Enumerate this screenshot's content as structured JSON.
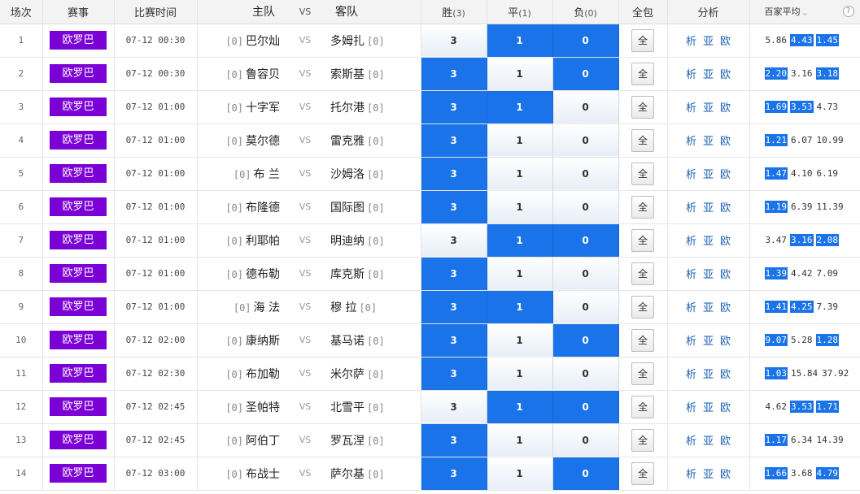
{
  "header": {
    "idx": "场次",
    "league": "赛事",
    "time": "比赛时间",
    "home": "主队",
    "vs": "VS",
    "away": "客队",
    "win": "胜",
    "win_sub": "(3)",
    "draw": "平",
    "draw_sub": "(1)",
    "loss": "负",
    "loss_sub": "(0)",
    "all": "全包",
    "analysis": "分析",
    "avg": "百家平均",
    "chevron_icon": "chevron-down-icon",
    "help_icon": "help-icon",
    "help": "?"
  },
  "labels": {
    "vs": "VS",
    "all": "全",
    "ana": [
      "析",
      "亚",
      "欧"
    ]
  },
  "colors": {
    "league_badge": "#7b00d6",
    "selected_cell": "#1a73e8",
    "link": "#1a5fb4"
  },
  "rows": [
    {
      "idx": "1",
      "league": "欧罗巴",
      "time": "07-12 00:30",
      "home_hc": "[0]",
      "home": "巴尔灿",
      "away": "多姆扎",
      "away_hc": "[0]",
      "picks": [
        false,
        true,
        true
      ],
      "odds": [
        {
          "v": "5.86",
          "hi": false
        },
        {
          "v": "4.43",
          "hi": true
        },
        {
          "v": "1.45",
          "hi": true
        }
      ]
    },
    {
      "idx": "2",
      "league": "欧罗巴",
      "time": "07-12 00:30",
      "home_hc": "[0]",
      "home": "鲁容贝",
      "away": "索斯基",
      "away_hc": "[0]",
      "picks": [
        true,
        false,
        true
      ],
      "odds": [
        {
          "v": "2.20",
          "hi": true
        },
        {
          "v": "3.16",
          "hi": false
        },
        {
          "v": "3.18",
          "hi": true
        }
      ]
    },
    {
      "idx": "3",
      "league": "欧罗巴",
      "time": "07-12 01:00",
      "home_hc": "[0]",
      "home": "十字军",
      "away": "托尔港",
      "away_hc": "[0]",
      "picks": [
        true,
        true,
        false
      ],
      "odds": [
        {
          "v": "1.69",
          "hi": true
        },
        {
          "v": "3.53",
          "hi": true
        },
        {
          "v": "4.73",
          "hi": false
        }
      ]
    },
    {
      "idx": "4",
      "league": "欧罗巴",
      "time": "07-12 01:00",
      "home_hc": "[0]",
      "home": "莫尔德",
      "away": "雷克雅",
      "away_hc": "[0]",
      "picks": [
        true,
        false,
        false
      ],
      "odds": [
        {
          "v": "1.21",
          "hi": true
        },
        {
          "v": "6.07",
          "hi": false
        },
        {
          "v": "10.99",
          "hi": false
        }
      ]
    },
    {
      "idx": "5",
      "league": "欧罗巴",
      "time": "07-12 01:00",
      "home_hc": "[0]",
      "home": "布 兰",
      "away": "沙姆洛",
      "away_hc": "[0]",
      "picks": [
        true,
        false,
        false
      ],
      "odds": [
        {
          "v": "1.47",
          "hi": true
        },
        {
          "v": "4.10",
          "hi": false
        },
        {
          "v": "6.19",
          "hi": false
        }
      ]
    },
    {
      "idx": "6",
      "league": "欧罗巴",
      "time": "07-12 01:00",
      "home_hc": "[0]",
      "home": "布隆德",
      "away": "国际图",
      "away_hc": "[0]",
      "picks": [
        true,
        false,
        false
      ],
      "odds": [
        {
          "v": "1.19",
          "hi": true
        },
        {
          "v": "6.39",
          "hi": false
        },
        {
          "v": "11.39",
          "hi": false
        }
      ]
    },
    {
      "idx": "7",
      "league": "欧罗巴",
      "time": "07-12 01:00",
      "home_hc": "[0]",
      "home": "利耶帕",
      "away": "明迪纳",
      "away_hc": "[0]",
      "picks": [
        false,
        true,
        true
      ],
      "odds": [
        {
          "v": "3.47",
          "hi": false
        },
        {
          "v": "3.16",
          "hi": true
        },
        {
          "v": "2.08",
          "hi": true
        }
      ]
    },
    {
      "idx": "8",
      "league": "欧罗巴",
      "time": "07-12 01:00",
      "home_hc": "[0]",
      "home": "德布勒",
      "away": "库克斯",
      "away_hc": "[0]",
      "picks": [
        true,
        false,
        false
      ],
      "odds": [
        {
          "v": "1.39",
          "hi": true
        },
        {
          "v": "4.42",
          "hi": false
        },
        {
          "v": "7.09",
          "hi": false
        }
      ]
    },
    {
      "idx": "9",
      "league": "欧罗巴",
      "time": "07-12 01:00",
      "home_hc": "[0]",
      "home": "海 法",
      "away": "穆 拉",
      "away_hc": "[0]",
      "picks": [
        true,
        true,
        false
      ],
      "odds": [
        {
          "v": "1.41",
          "hi": true
        },
        {
          "v": "4.25",
          "hi": true
        },
        {
          "v": "7.39",
          "hi": false
        }
      ]
    },
    {
      "idx": "10",
      "league": "欧罗巴",
      "time": "07-12 02:00",
      "home_hc": "[0]",
      "home": "康纳斯",
      "away": "基马诺",
      "away_hc": "[0]",
      "picks": [
        true,
        false,
        true
      ],
      "odds": [
        {
          "v": "9.07",
          "hi": true
        },
        {
          "v": "5.28",
          "hi": false
        },
        {
          "v": "1.28",
          "hi": true
        }
      ]
    },
    {
      "idx": "11",
      "league": "欧罗巴",
      "time": "07-12 02:30",
      "home_hc": "[0]",
      "home": "布加勒",
      "away": "米尔萨",
      "away_hc": "[0]",
      "picks": [
        true,
        false,
        false
      ],
      "odds": [
        {
          "v": "1.03",
          "hi": true
        },
        {
          "v": "15.84",
          "hi": false
        },
        {
          "v": "37.92",
          "hi": false
        }
      ]
    },
    {
      "idx": "12",
      "league": "欧罗巴",
      "time": "07-12 02:45",
      "home_hc": "[0]",
      "home": "圣帕特",
      "away": "北雪平",
      "away_hc": "[0]",
      "picks": [
        false,
        true,
        true
      ],
      "odds": [
        {
          "v": "4.62",
          "hi": false
        },
        {
          "v": "3.53",
          "hi": true
        },
        {
          "v": "1.71",
          "hi": true
        }
      ]
    },
    {
      "idx": "13",
      "league": "欧罗巴",
      "time": "07-12 02:45",
      "home_hc": "[0]",
      "home": "阿伯丁",
      "away": "罗瓦涅",
      "away_hc": "[0]",
      "picks": [
        true,
        false,
        false
      ],
      "odds": [
        {
          "v": "1.17",
          "hi": true
        },
        {
          "v": "6.34",
          "hi": false
        },
        {
          "v": "14.39",
          "hi": false
        }
      ]
    },
    {
      "idx": "14",
      "league": "欧罗巴",
      "time": "07-12 03:00",
      "home_hc": "[0]",
      "home": "布战士",
      "away": "萨尔基",
      "away_hc": "[0]",
      "picks": [
        true,
        false,
        true
      ],
      "odds": [
        {
          "v": "1.66",
          "hi": true
        },
        {
          "v": "3.68",
          "hi": false
        },
        {
          "v": "4.79",
          "hi": true
        }
      ]
    }
  ]
}
